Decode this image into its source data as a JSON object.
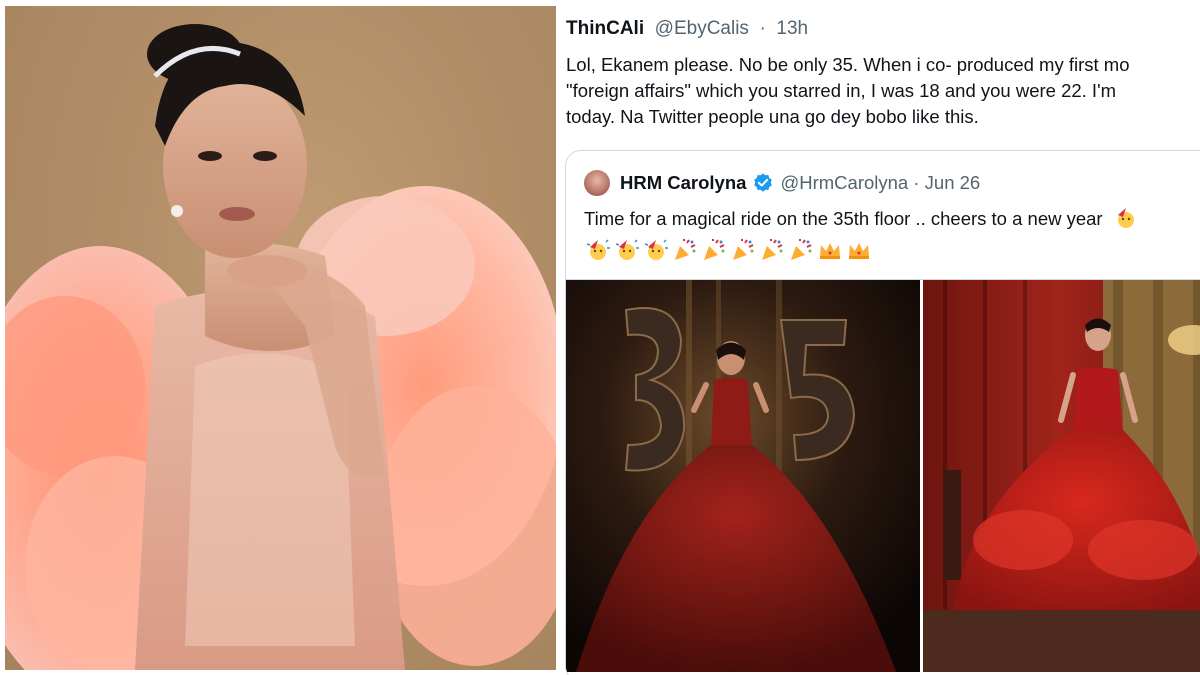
{
  "tweet": {
    "author_name": "ThinCAli",
    "author_handle": "@EbyCalis",
    "separator": "·",
    "timestamp": "13h",
    "text_lines": [
      "Lol, Ekanem please. No be only 35. When i co- produced my first mo",
      "\"foreign affairs\" which you starred in, I was 18 and you were 22. I'm",
      "today. Na Twitter people una go dey bobo like this."
    ]
  },
  "quoted_tweet": {
    "author_name": "HRM Carolyna",
    "verified": true,
    "author_handle": "@HrmCarolyna",
    "separator": "·",
    "date": "Jun 26",
    "text": "Time for a magical ride on the 35th floor .. cheers to a new year",
    "emojis": [
      "party-face",
      "party-face",
      "party-face",
      "party-face",
      "party-popper",
      "party-popper",
      "party-popper",
      "party-popper",
      "party-popper",
      "crown",
      "crown"
    ],
    "photos": [
      "balloon-35-red-gown-photo",
      "red-gown-seated-photo"
    ]
  },
  "colors": {
    "text_primary": "#0f1419",
    "text_secondary": "#536471",
    "verified_blue": "#1d9bf0",
    "border": "#cfd9de"
  }
}
